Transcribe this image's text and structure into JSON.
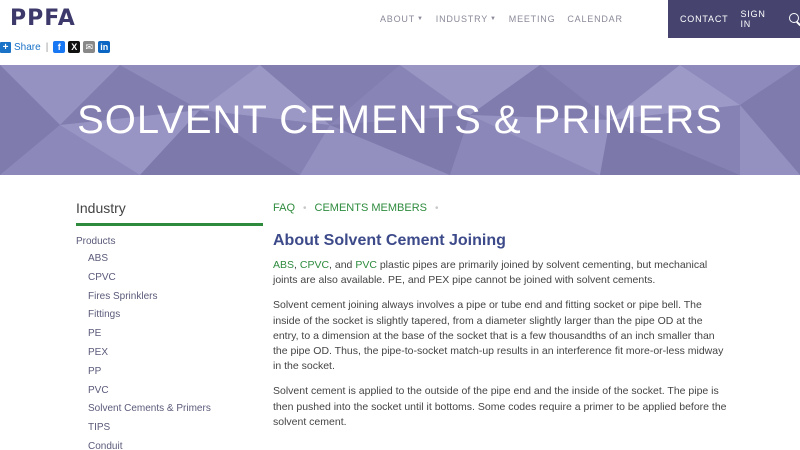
{
  "header": {
    "logo": "PPFA",
    "nav": [
      {
        "label": "ABOUT",
        "dropdown": true
      },
      {
        "label": "INDUSTRY",
        "dropdown": true
      },
      {
        "label": "MEETING",
        "dropdown": false
      },
      {
        "label": "CALENDAR",
        "dropdown": false
      }
    ],
    "utility": {
      "contact": "CONTACT",
      "signin": "SIGN IN"
    }
  },
  "share": {
    "label": "Share",
    "separator": "|",
    "networks": [
      "facebook",
      "x",
      "email",
      "linkedin"
    ]
  },
  "hero": {
    "title": "SOLVENT CEMENTS & PRIMERS"
  },
  "sidebar": {
    "title": "Industry",
    "parent": "Products",
    "items": [
      "ABS",
      "CPVC",
      "Fires Sprinklers",
      "Fittings",
      "PE",
      "PEX",
      "PP",
      "PVC",
      "Solvent Cements & Primers",
      "TIPS",
      "Conduit"
    ]
  },
  "main": {
    "tabs": [
      "FAQ",
      "CEMENTS MEMBERS"
    ],
    "title": "About Solvent Cement Joining",
    "p1": {
      "link1": "ABS",
      "sep1": ", ",
      "link2": "CPVC",
      "sep2": ", and ",
      "link3": "PVC",
      "rest": " plastic pipes are primarily joined by solvent cementing, but mechanical joints are also available. PE, and PEX pipe cannot be joined with solvent cements."
    },
    "p2": "Solvent cement joining always involves a pipe or tube end and fitting socket or pipe bell. The inside of the socket is slightly tapered, from a diameter slightly larger than the pipe OD at the entry, to a dimension at the base of the socket that is a few thousandths of an inch smaller than the pipe OD. Thus, the pipe-to-socket match-up results in an interference fit more-or-less midway in the socket.",
    "p3": "Solvent cement is applied to the outside of the pipe end and the inside of the socket. The pipe is then pushed into the socket until it bottoms. Some codes require a primer to be applied before the solvent cement."
  },
  "colors": {
    "brand": "#46446f",
    "link": "#2e8b3e",
    "heading": "#3d4a8a",
    "hero": "#8a86b6"
  }
}
